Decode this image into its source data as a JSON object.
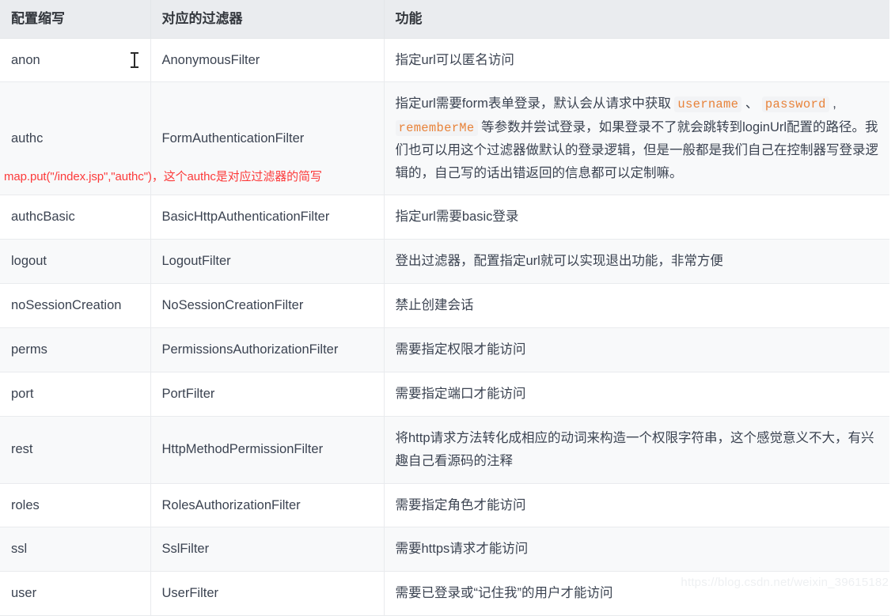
{
  "table": {
    "headers": [
      "配置缩写",
      "对应的过滤器",
      "功能"
    ],
    "rows": [
      {
        "abbr": "anon",
        "filter": "AnonymousFilter",
        "desc": "指定url可以匿名访问",
        "has_cursor": true
      },
      {
        "abbr": "authc",
        "filter": "FormAuthenticationFilter",
        "desc_part1": "指定url需要form表单登录，默认会从请求中获取 ",
        "code1": "username",
        "sep1": " 、 ",
        "code2": "password",
        "sep2": " , ",
        "code3": "rememberMe",
        "desc_part2": " 等参数并尝试登录，如果登录不了就会跳转到loginUrl配置的路径。我们也可以用这个过滤器做默认的登录逻辑，但是一般都是我们自己在控制器写登录逻辑的，自己写的话出错返回的信息都可以定制嘛。",
        "has_cursor": false
      },
      {
        "abbr": "authcBasic",
        "filter": "BasicHttpAuthenticationFilter",
        "desc": "指定url需要basic登录",
        "has_cursor": false
      },
      {
        "abbr": "logout",
        "filter": "LogoutFilter",
        "desc": "登出过滤器，配置指定url就可以实现退出功能，非常方便",
        "has_cursor": false
      },
      {
        "abbr": "noSessionCreation",
        "filter": "NoSessionCreationFilter",
        "desc": "禁止创建会话",
        "has_cursor": false
      },
      {
        "abbr": "perms",
        "filter": "PermissionsAuthorizationFilter",
        "desc": "需要指定权限才能访问",
        "has_cursor": false
      },
      {
        "abbr": "port",
        "filter": "PortFilter",
        "desc": "需要指定端口才能访问",
        "has_cursor": false
      },
      {
        "abbr": "rest",
        "filter": "HttpMethodPermissionFilter",
        "desc": "将http请求方法转化成相应的动词来构造一个权限字符串，这个感觉意义不大，有兴趣自己看源码的注释",
        "has_cursor": false
      },
      {
        "abbr": "roles",
        "filter": "RolesAuthorizationFilter",
        "desc": "需要指定角色才能访问",
        "has_cursor": false
      },
      {
        "abbr": "ssl",
        "filter": "SslFilter",
        "desc": "需要https请求才能访问",
        "has_cursor": false
      },
      {
        "abbr": "user",
        "filter": "UserFilter",
        "desc": "需要已登录或“记住我”的用户才能访问",
        "has_cursor": false
      }
    ]
  },
  "annotation": {
    "text": "map.put(\"/index.jsp\",\"authc\")，这个authc是对应过滤器的简写",
    "color": "#fc3a3a"
  },
  "watermark": {
    "text": "https://blog.csdn.net/weixin_39615182"
  },
  "colors": {
    "header_bg": "#eaecef",
    "stripe_bg": "#f8f9fa",
    "row_bg": "#ffffff",
    "border": "#e9ebee",
    "text": "#3b4351",
    "code_text": "#e8833a",
    "code_bg": "#f2f3f5",
    "annotation": "#fc3a3a",
    "watermark": "#eef0f2"
  }
}
